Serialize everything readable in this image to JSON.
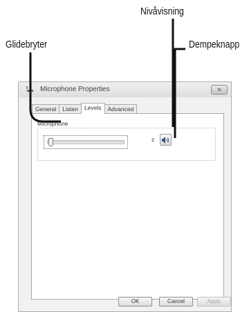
{
  "callouts": {
    "level_display": "Nivåvisning",
    "slider": "Glidebryter",
    "mute_button": "Dempeknapp"
  },
  "window": {
    "title": "Microphone Properties",
    "close_glyph": "✕"
  },
  "tabs": [
    {
      "label": "General",
      "active": false
    },
    {
      "label": "Listen",
      "active": false
    },
    {
      "label": "Levels",
      "active": true
    },
    {
      "label": "Advanced",
      "active": false
    }
  ],
  "levels": {
    "group_label": "Microphone",
    "level_value": "2",
    "slider_fraction": 0.02
  },
  "buttons": {
    "ok": "OK",
    "cancel": "Cancel",
    "apply": "Apply"
  },
  "colors": {
    "callout_line": "#111111"
  }
}
